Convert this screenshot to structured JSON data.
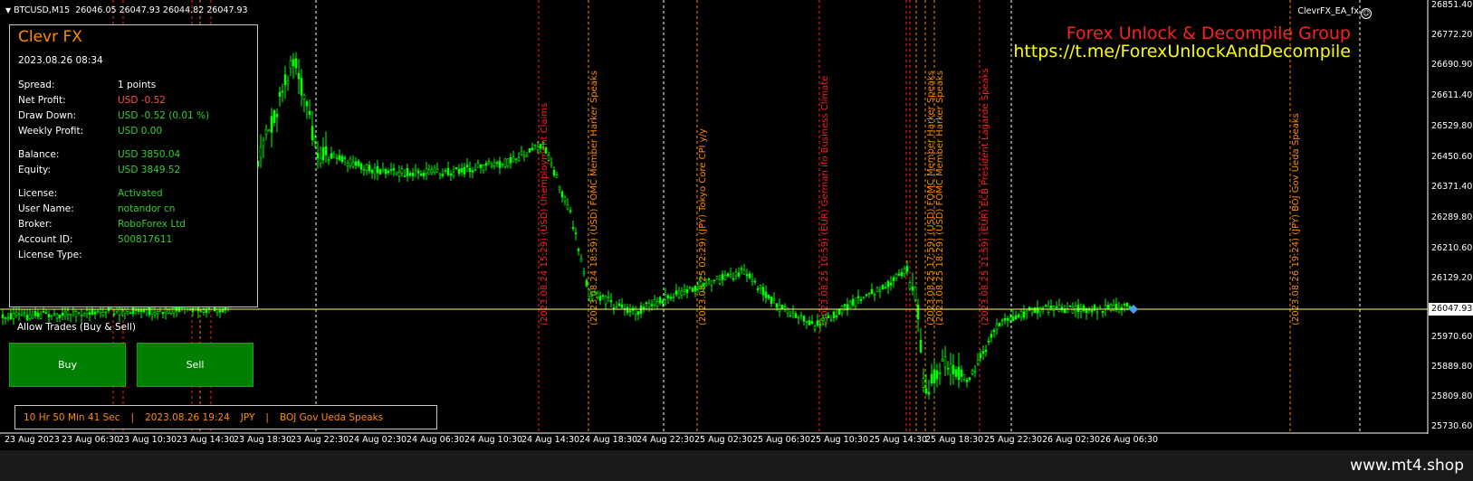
{
  "symbol_bar": {
    "symbol": "BTCUSD,M15",
    "quote": "26046.05 26047.93 26044.82 26047.93"
  },
  "ea_name": "ClevrFX_EA_fx",
  "brand": {
    "line1": "Forex Unlock & Decompile Group",
    "line2": "https://t.me/ForexUnlockAndDecompile"
  },
  "panel": {
    "title": "Clevr FX",
    "datetime": "2023.08.26 08:34",
    "rows": [
      {
        "label": "Spread:",
        "value": "1 points"
      },
      {
        "label": "Net Profit:",
        "value": "USD -0.52"
      },
      {
        "label": "Draw Down:",
        "value": "USD -0.52 (0.01 %)"
      },
      {
        "label": "Weekly Profit:",
        "value": "USD 0.00"
      },
      {
        "label": "Balance:",
        "value": "USD 3850.04"
      },
      {
        "label": "Equity:",
        "value": "USD 3849.52"
      },
      {
        "label": "License:",
        "value": "Activated"
      },
      {
        "label": "User Name:",
        "value": "notandor cn"
      },
      {
        "label": "Broker:",
        "value": "RoboForex Ltd"
      },
      {
        "label": "Account ID:",
        "value": "500817611"
      },
      {
        "label": "License Type:",
        "value": ""
      }
    ]
  },
  "allow_trades": "Allow Trades (Buy & Sell)",
  "buttons": {
    "buy": "Buy",
    "sell": "Sell"
  },
  "news": {
    "countdown": "10 Hr 50 Min 41 Sec",
    "time": "2023.08.26 19:24",
    "currency": "JPY",
    "event": "BOJ Gov Ueda Speaks",
    "separator": "|"
  },
  "price_axis": [
    "26851.40",
    "26772.20",
    "26690.90",
    "26611.40",
    "26529.80",
    "26450.60",
    "26371.40",
    "26289.80",
    "26210.60",
    "26129.20",
    "25970.60",
    "25889.80",
    "25809.80",
    "25730.60"
  ],
  "current_price": "26047.93",
  "time_axis": [
    "23 Aug 2023",
    "23 Aug 06:30",
    "23 Aug 10:30",
    "23 Aug 14:30",
    "23 Aug 18:30",
    "23 Aug 22:30",
    "24 Aug 02:30",
    "24 Aug 06:30",
    "24 Aug 10:30",
    "24 Aug 14:30",
    "24 Aug 18:30",
    "24 Aug 22:30",
    "25 Aug 02:30",
    "25 Aug 06:30",
    "25 Aug 10:30",
    "25 Aug 14:30",
    "25 Aug 18:30",
    "25 Aug 22:30",
    "26 Aug 02:30",
    "26 Aug 06:30"
  ],
  "events": [
    {
      "text": "(2023.08.24 15:29) (USD) Unemployment Claims",
      "color": "#ff2020"
    },
    {
      "text": "(2023.08.24 18:59) (USD) FOMC Member Harker Speaks",
      "color": "#ff8c00"
    },
    {
      "text": "(2023.08.25 02:29) (JPY) Tokyo Core CPI y/y",
      "color": "#ff8c00"
    },
    {
      "text": "(2023.08.25 10:59) (EUR) German ifo Business Climate",
      "color": "#ff2020"
    },
    {
      "text": "(2023.08.25 17:59) (USD) FOMC Member Harker Speaks",
      "color": "#ff8c00"
    },
    {
      "text": "(2023.08.25 18:29) (USD) FOMC Member Harker Speaks",
      "color": "#ff8c00"
    },
    {
      "text": "(2023.08.25 21:59) (EUR) ECB President Lagarde Speaks",
      "color": "#ff2020"
    },
    {
      "text": "(2023.08.26 19:24) (JPY) BOJ Gov Ueda Speaks",
      "color": "#ff8c00"
    }
  ],
  "site": "www.mt4.shop",
  "colors": {
    "candle": "#00ff00",
    "price_line": "#ffff60",
    "high_impact": "#ff2020",
    "medium_impact": "#ff8c00",
    "session_line": "#ffffff"
  }
}
